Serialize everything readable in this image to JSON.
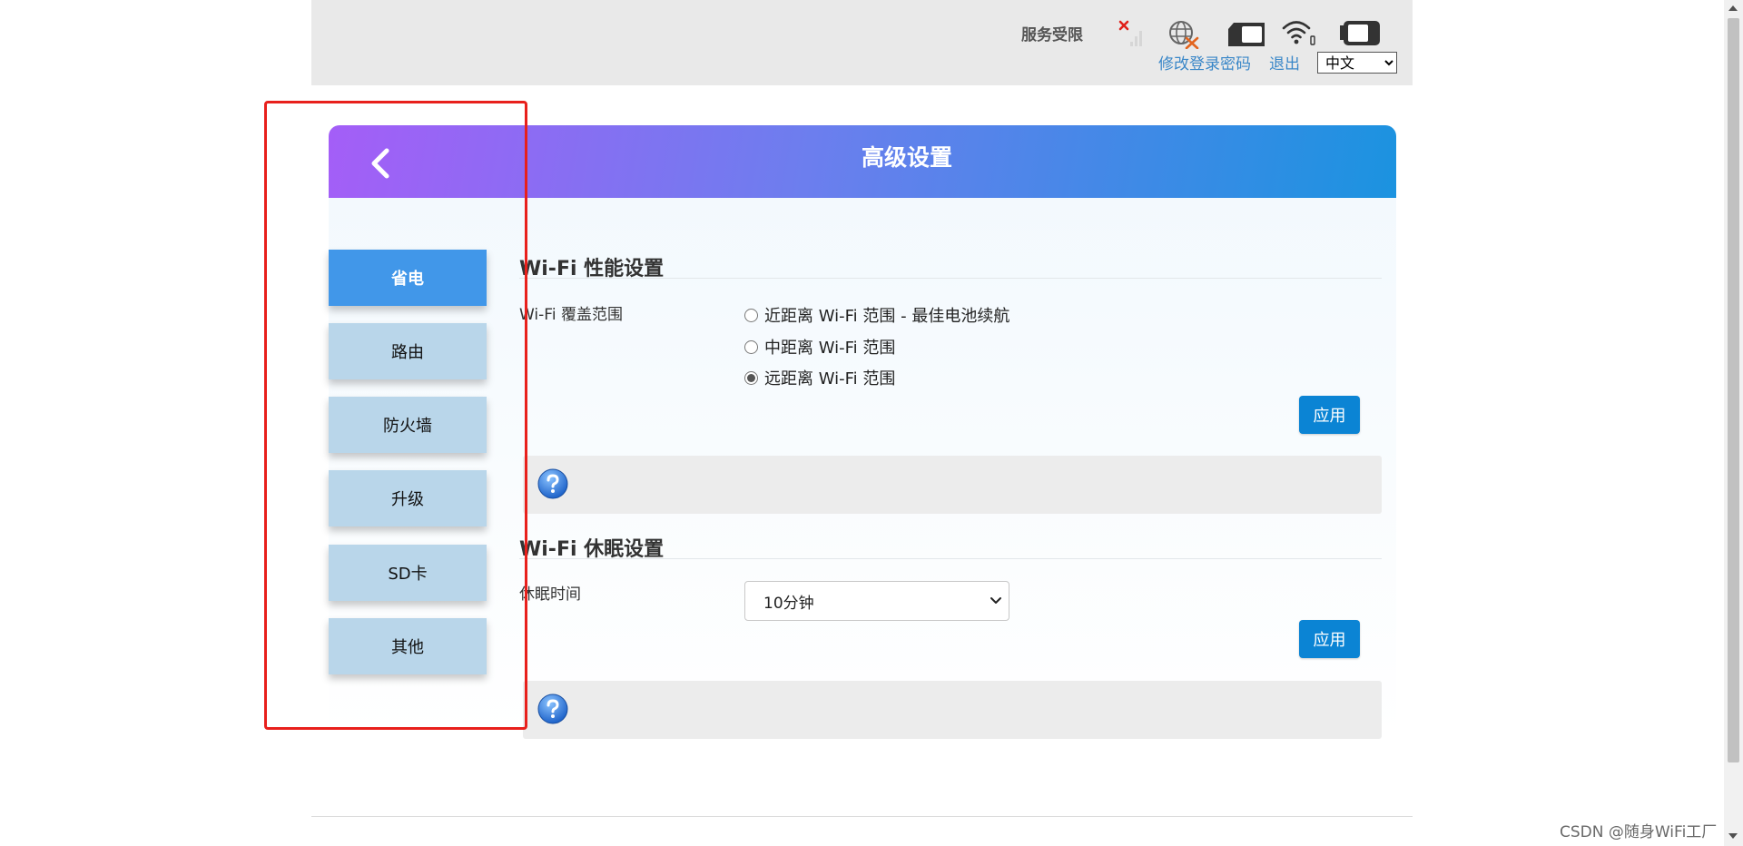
{
  "topbar": {
    "service_status": "服务受限",
    "icons": [
      "signal-none-icon",
      "globe-disconnected-icon",
      "sim-card-icon",
      "wifi-status-icon",
      "battery-icon"
    ],
    "change_password_link": "修改登录密码",
    "logout_link": "退出",
    "language": {
      "selected": "中文"
    }
  },
  "page": {
    "title": "高级设置"
  },
  "sidebar": {
    "items": [
      {
        "label": "省电",
        "active": true
      },
      {
        "label": "路由",
        "active": false
      },
      {
        "label": "防火墙",
        "active": false
      },
      {
        "label": "升级",
        "active": false
      },
      {
        "label": "SD卡",
        "active": false
      },
      {
        "label": "其他",
        "active": false
      }
    ]
  },
  "wifi_performance": {
    "title": "Wi-Fi 性能设置",
    "coverage_label": "Wi-Fi 覆盖范围",
    "options": [
      {
        "label": "近距离 Wi-Fi 范围 - 最佳电池续航",
        "checked": false
      },
      {
        "label": "中距离 Wi-Fi 范围",
        "checked": false
      },
      {
        "label": "远距离 Wi-Fi 范围",
        "checked": true
      }
    ],
    "apply_label": "应用"
  },
  "wifi_sleep": {
    "title": "Wi-Fi 休眠设置",
    "sleep_label": "休眠时间",
    "sleep_value": "10分钟",
    "apply_label": "应用"
  },
  "footer": {
    "watermark": "CSDN @随身WiFi工厂"
  },
  "colors": {
    "active_tab": "#4197e9",
    "inactive_tab": "#b9d6ea",
    "apply_button": "#0b84d4",
    "header_gradient_start": "#a45ef7",
    "header_gradient_end": "#1b93e0",
    "annotation": "#e8201c",
    "link": "#3a87c8"
  }
}
